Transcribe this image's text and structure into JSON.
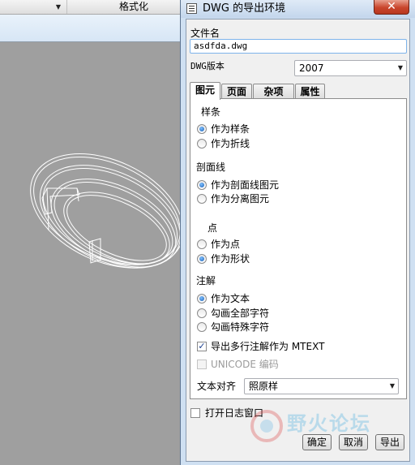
{
  "background_app": {
    "toolbar": {
      "format_label": "格式化"
    }
  },
  "dialog": {
    "title": "DWG 的导出环境",
    "close_glyph": "✕",
    "filename_label": "文件名",
    "filename_value": "asdfda.dwg",
    "version_label": "DWG版本",
    "version_value": "2007",
    "tabs": [
      {
        "label": "图元",
        "active": true
      },
      {
        "label": "页面",
        "active": false
      },
      {
        "label": "杂项",
        "active": false
      },
      {
        "label": "属性",
        "active": false
      }
    ],
    "sections": {
      "spline": {
        "heading": "样条",
        "options": [
          {
            "label": "作为样条",
            "selected": true
          },
          {
            "label": "作为折线",
            "selected": false
          }
        ]
      },
      "hatch": {
        "heading": "剖面线",
        "options": [
          {
            "label": "作为剖面线图元",
            "selected": true
          },
          {
            "label": "作为分离图元",
            "selected": false
          }
        ]
      },
      "point": {
        "heading": "点",
        "options": [
          {
            "label": "作为点",
            "selected": false
          },
          {
            "label": "作为形状",
            "selected": true
          }
        ]
      },
      "annotation": {
        "heading": "注解",
        "options": [
          {
            "label": "作为文本",
            "selected": true
          },
          {
            "label": "勾画全部字符",
            "selected": false
          },
          {
            "label": "勾画特殊字符",
            "selected": false
          }
        ],
        "mtext_checkbox": {
          "label": "导出多行注解作为 MTEXT",
          "checked": true
        },
        "unicode_checkbox": {
          "label": "UNICODE 编码",
          "checked": false,
          "disabled": true
        }
      }
    },
    "text_align_label": "文本对齐",
    "text_align_value": "照原样",
    "log_window_checkbox": {
      "label": "打开日志窗口",
      "checked": false
    },
    "buttons": {
      "ok": "确定",
      "cancel": "取消",
      "export": "导出"
    },
    "watermark_text": "野火论坛"
  },
  "colors": {
    "accent": "#1a5fb4",
    "dialog_frame": "#cfe0f2",
    "close_red": "#c9452c"
  }
}
